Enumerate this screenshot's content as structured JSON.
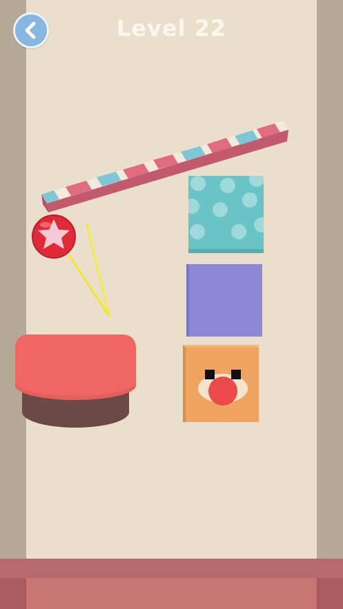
{
  "header": {
    "back_icon": "chevron-left-icon",
    "level_label": "Level 22"
  },
  "colors": {
    "background": "#e9dfcc",
    "walls": "#b3a996",
    "floor": "#c87574",
    "back_button": "#85b7e0",
    "plank_pink": "#e06c80",
    "plank_white": "#f3e9dc",
    "plank_blue": "#7cc6d6",
    "ball_red": "#e02a38",
    "drawn_line": "#f2e72a",
    "cup_red": "#f06663",
    "cup_brown": "#6b4a45",
    "cube_teal": "#6ac3c5",
    "cube_purple": "#8e87d3",
    "cube_orange": "#f0a35f"
  },
  "scene": {
    "plank": "striped-plank",
    "ball": "red-star-ball",
    "drawn_line": "yellow-drawn-line",
    "cup": "red-cup-target",
    "cubes": [
      "teal-polka-dot-cube",
      "purple-cube",
      "orange-clown-cube"
    ]
  }
}
